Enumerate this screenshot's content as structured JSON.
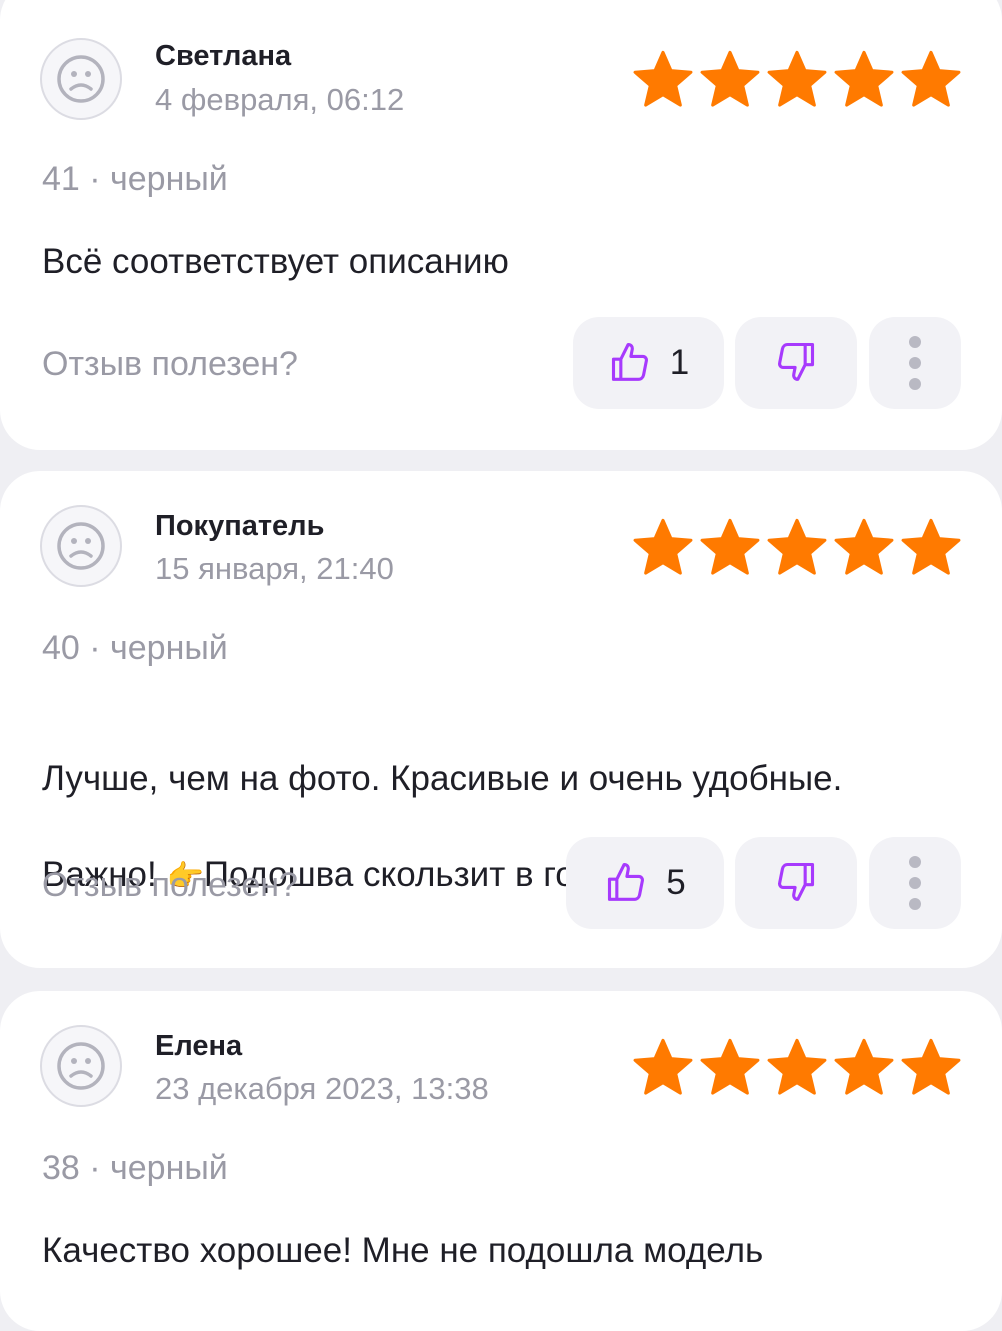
{
  "colors": {
    "star": "#ff7a00",
    "thumb": "#a73afd",
    "muted": "#9a9aa5",
    "card_bg": "#ffffff",
    "page_bg": "#efeff3"
  },
  "icons": {
    "avatar": "sad-face-icon",
    "star": "star-icon",
    "like": "thumbs-up-icon",
    "dislike": "thumbs-down-icon",
    "more": "more-vertical-icon"
  },
  "reviews": [
    {
      "author": "Светлана",
      "date": "4 февраля, 06:12",
      "rating": 5,
      "variant": "41 · черный",
      "text": "Всё соответствует описанию",
      "helpful_label": "Отзыв полезен?",
      "likes": "1"
    },
    {
      "author": "Покупатель",
      "date": "15 января, 21:40",
      "rating": 5,
      "variant": "40 · черный",
      "text_line1": "Лучше, чем на фото. Красивые и очень удобные.",
      "text_line2_prefix": "Важно! ",
      "text_line2_emoji": "👉",
      "text_line2_suffix": "Подошва скользит в гололёд.",
      "helpful_label": "Отзыв полезен?",
      "likes": "5"
    },
    {
      "author": "Елена",
      "date": "23 декабря 2023, 13:38",
      "rating": 5,
      "variant": "38 · черный",
      "text": "Качество хорошее! Мне не подошла модель"
    }
  ]
}
